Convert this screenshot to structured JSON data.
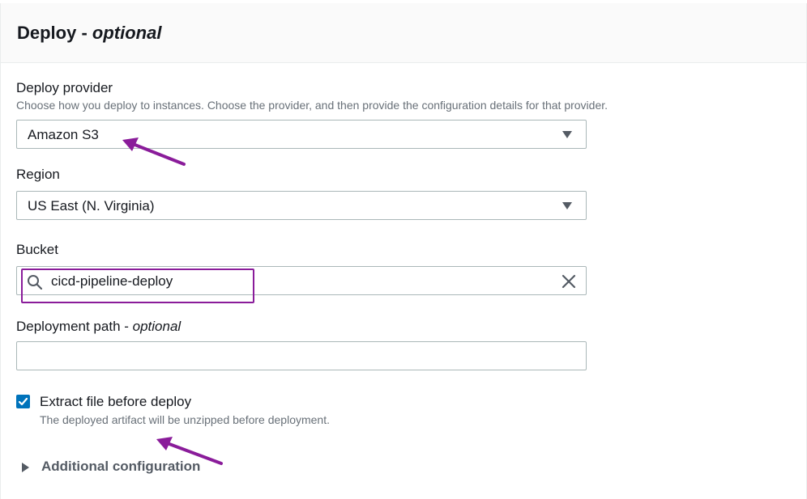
{
  "section": {
    "title": "Deploy - ",
    "title_optional": "optional"
  },
  "deploy_provider": {
    "label": "Deploy provider",
    "description": "Choose how you deploy to instances. Choose the provider, and then provide the configuration details for that provider.",
    "value": "Amazon S3"
  },
  "region": {
    "label": "Region",
    "value": "US East (N. Virginia)"
  },
  "bucket": {
    "label": "Bucket",
    "value": "cicd-pipeline-deploy"
  },
  "deployment_path": {
    "label": "Deployment path - ",
    "label_optional": "optional",
    "value": ""
  },
  "extract": {
    "checked": true,
    "label": "Extract file before deploy",
    "description": "The deployed artifact will be unzipped before deployment."
  },
  "additional": {
    "label": "Additional configuration"
  },
  "colors": {
    "accent": "#0073bb",
    "annotation": "#8a1c9a"
  },
  "icons": {
    "dropdown": "caret-down-icon",
    "search": "search-icon",
    "clear": "close-icon",
    "check": "check-icon",
    "expand": "caret-right-icon"
  }
}
